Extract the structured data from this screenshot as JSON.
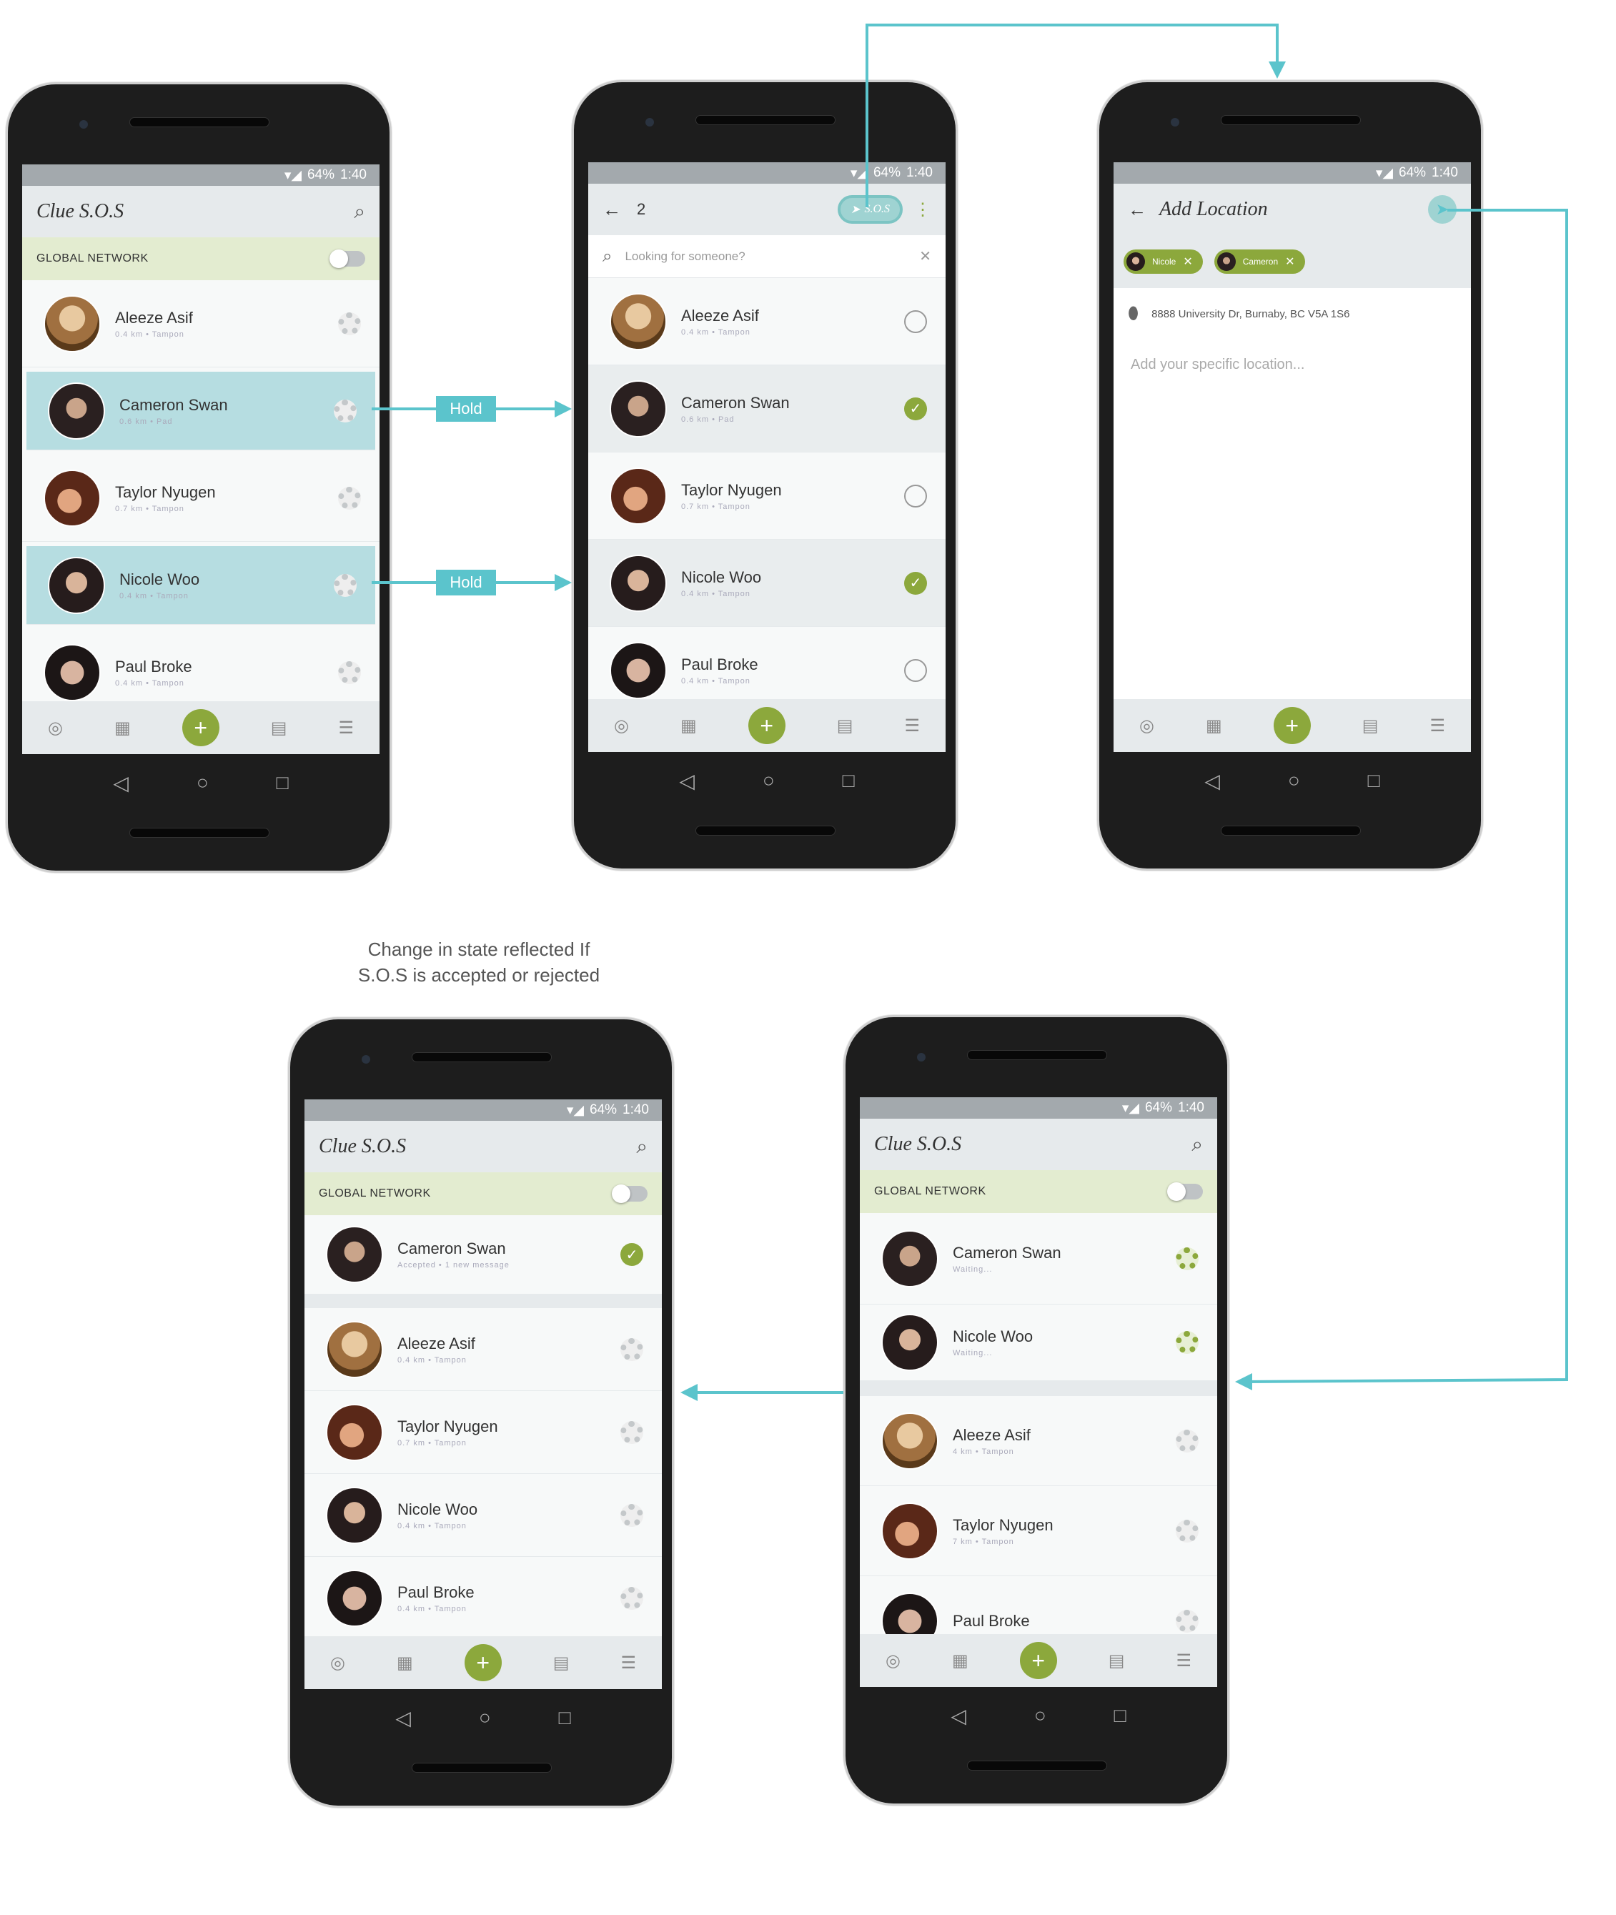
{
  "colors": {
    "accent": "#5bc4cc",
    "green": "#8ca83c",
    "highlight": "#b6dde1"
  },
  "status": {
    "battery": "64%",
    "time": "1:40"
  },
  "app": {
    "title": "Clue S.O.S",
    "network": "GLOBAL NETWORK"
  },
  "people": {
    "aleeze": {
      "name": "Aleeze Asif",
      "sub": "0.4 km • Tampon"
    },
    "cameron": {
      "name": "Cameron Swan",
      "sub": "0.6 km • Pad"
    },
    "taylor": {
      "name": "Taylor Nyugen",
      "sub": "0.7 km • Tampon"
    },
    "nicole": {
      "name": "Nicole Woo",
      "sub": "0.4 km • Tampon"
    },
    "paul": {
      "name": "Paul Broke",
      "sub": "0.4 km • Tampon"
    }
  },
  "screen2": {
    "count": "2",
    "sos_label": "S.O.S",
    "search_placeholder": "Looking for someone?"
  },
  "screen3": {
    "title": "Add Location",
    "chip1": "Nicole",
    "chip2": "Cameron",
    "address": "8888 University Dr, Burnaby, BC V5A 1S6",
    "specific_placeholder": "Add your specific location..."
  },
  "screen4": {
    "cameron_sub": "Accepted • 1 new message",
    "aleeze_sub": "0.4 km • Tampon",
    "taylor_sub": "0.7 km • Tampon",
    "nicole_sub": "0.4 km • Tampon",
    "paul_sub": "0.4 km • Tampon"
  },
  "screen5": {
    "cameron_sub": "Waiting...",
    "nicole_sub": "Waiting...",
    "aleeze_sub": "4 km • Tampon",
    "taylor_sub": "7 km • Tampon"
  },
  "annotations": {
    "hold1": "Hold",
    "hold2": "Hold",
    "caption_line1": "Change in state reflected If",
    "caption_line2": "S.O.S is accepted or rejected"
  },
  "icons": {
    "search": "search-icon",
    "back": "back-arrow-icon",
    "send": "send-icon",
    "close": "close-icon",
    "pin": "location-pin-icon",
    "menu": "more-vert-icon",
    "lifebuoy": "lifebuoy-icon",
    "check": "check-icon"
  },
  "navbar": {
    "back": "◁",
    "home": "○",
    "recent": "□"
  }
}
